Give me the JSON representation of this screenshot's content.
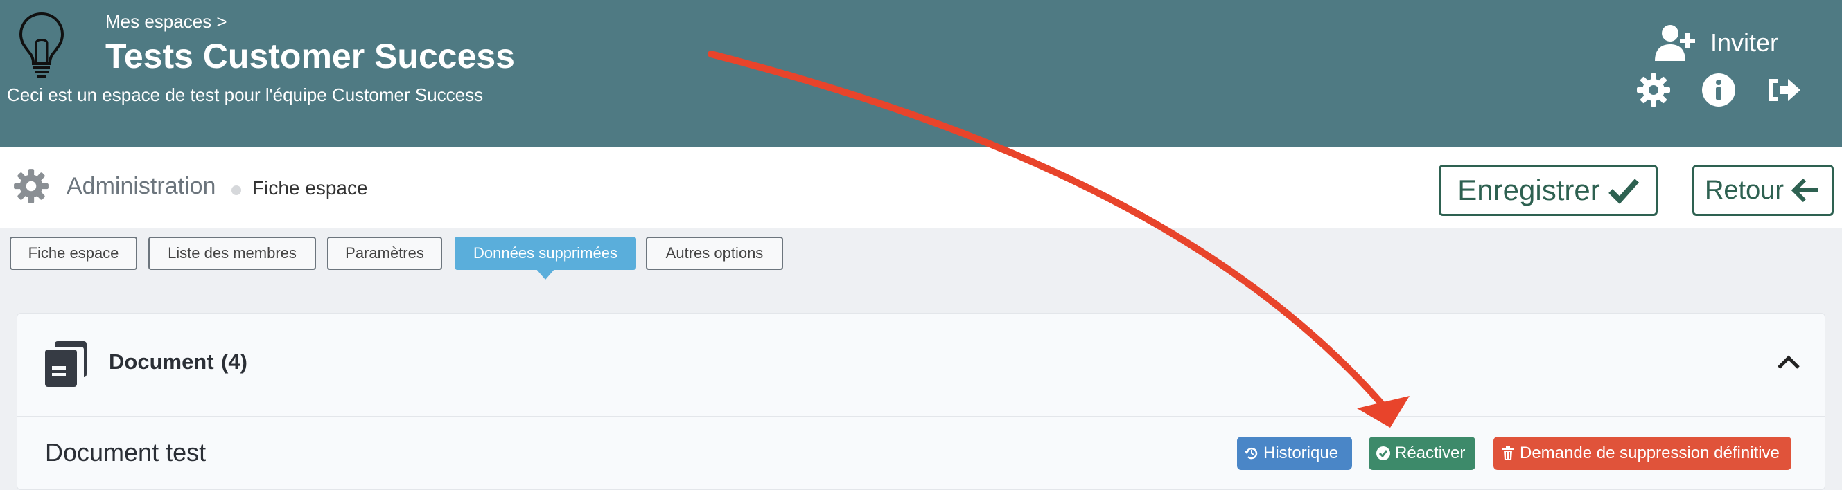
{
  "header": {
    "breadcrumb": "Mes espaces >",
    "title": "Tests Customer Success",
    "description": "Ceci est un espace de test pour l'équipe Customer Success",
    "invite_label": "Inviter",
    "bg_color": "#4f7a83"
  },
  "admin": {
    "title": "Administration",
    "subtitle": "Fiche espace",
    "save_label": "Enregistrer",
    "back_label": "Retour",
    "accent_color": "#2e6151"
  },
  "tabs": [
    {
      "label": "Fiche espace",
      "active": false
    },
    {
      "label": "Liste des membres",
      "active": false
    },
    {
      "label": "Paramètres",
      "active": false
    },
    {
      "label": "Données supprimées",
      "active": true
    },
    {
      "label": "Autres options",
      "active": false
    }
  ],
  "section": {
    "title": "Document",
    "count": "(4)"
  },
  "row": {
    "name": "Document test",
    "history_label": "Historique",
    "reactivate_label": "Réactiver",
    "delete_label": "Demande de suppression définitive"
  },
  "icons": {
    "logo": "lightbulb-icon",
    "invite": "user-plus-icon",
    "settings": "gear-icon",
    "info": "info-icon",
    "logout": "logout-icon",
    "save": "check-icon",
    "back": "arrow-left-icon",
    "document": "documents-icon",
    "collapse": "chevron-up-icon",
    "history": "history-icon",
    "reactivate": "check-circle-icon",
    "delete": "trash-icon"
  },
  "annotation": {
    "arrow_color": "#e8442b"
  }
}
